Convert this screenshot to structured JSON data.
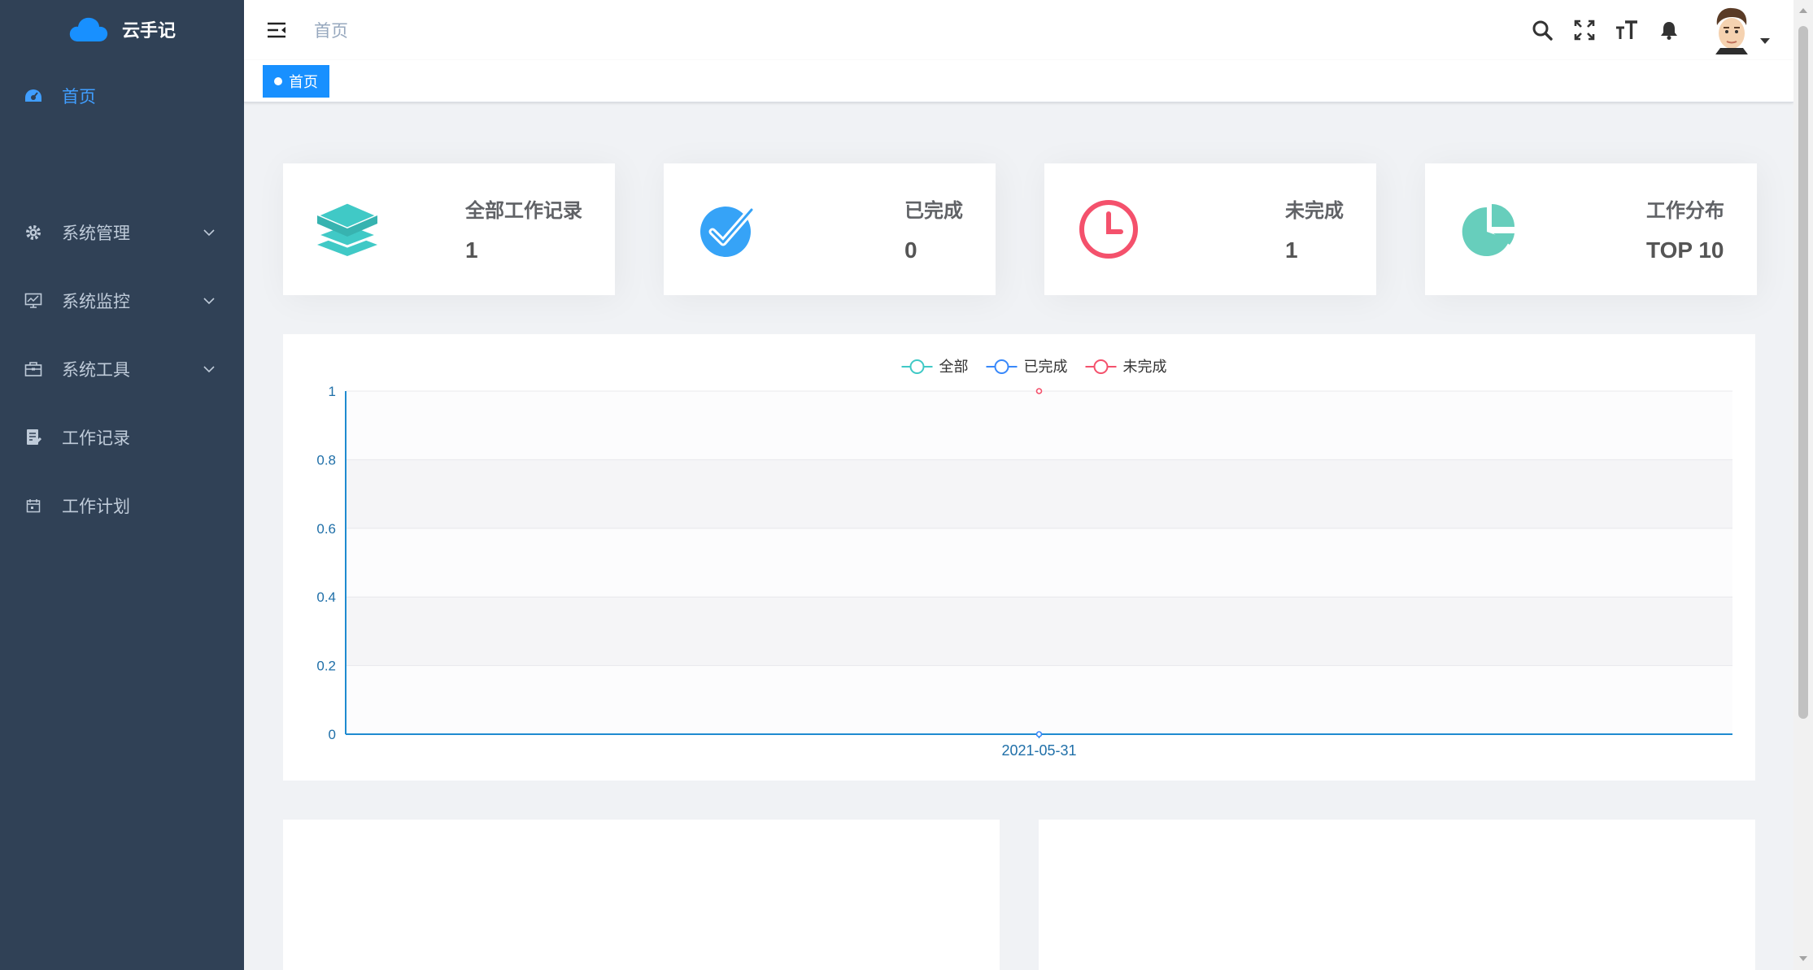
{
  "app": {
    "name": "云手记"
  },
  "sidebar": {
    "items": [
      {
        "label": "首页",
        "icon": "dashboard-icon",
        "active": true
      },
      {
        "label": "系统管理",
        "icon": "gear-icon",
        "expandable": true
      },
      {
        "label": "系统监控",
        "icon": "monitor-icon",
        "expandable": true
      },
      {
        "label": "系统工具",
        "icon": "toolbox-icon",
        "expandable": true
      },
      {
        "label": "工作记录",
        "icon": "document-edit-icon"
      },
      {
        "label": "工作计划",
        "icon": "calendar-icon"
      }
    ]
  },
  "navbar": {
    "breadcrumb": "首页",
    "icons": [
      "search-icon",
      "fullscreen-icon",
      "font-size-icon",
      "bell-icon"
    ]
  },
  "tags": [
    {
      "label": "首页",
      "active": true
    }
  ],
  "cards": [
    {
      "title": "全部工作记录",
      "value": "1",
      "icon": "layers-icon",
      "color": "#40c9c6"
    },
    {
      "title": "已完成",
      "value": "0",
      "icon": "check-circle-icon",
      "color": "#36a3f7"
    },
    {
      "title": "未完成",
      "value": "1",
      "icon": "clock-icon",
      "color": "#f4516c"
    },
    {
      "title": "工作分布",
      "value": "TOP 10",
      "icon": "pie-chart-icon",
      "color": "#67cebc"
    }
  ],
  "chart_data": {
    "type": "line",
    "x": [
      "2021-05-31"
    ],
    "series": [
      {
        "name": "全部",
        "values": [
          null
        ],
        "color": "#40c9c6"
      },
      {
        "name": "已完成",
        "values": [
          0
        ],
        "color": "#3888fa"
      },
      {
        "name": "未完成",
        "values": [
          1
        ],
        "color": "#f4516c"
      }
    ],
    "yticks": [
      "0",
      "0.2",
      "0.4",
      "0.6",
      "0.8",
      "1"
    ],
    "ylim": [
      0,
      1
    ],
    "grid": true,
    "legend": "top-center"
  }
}
